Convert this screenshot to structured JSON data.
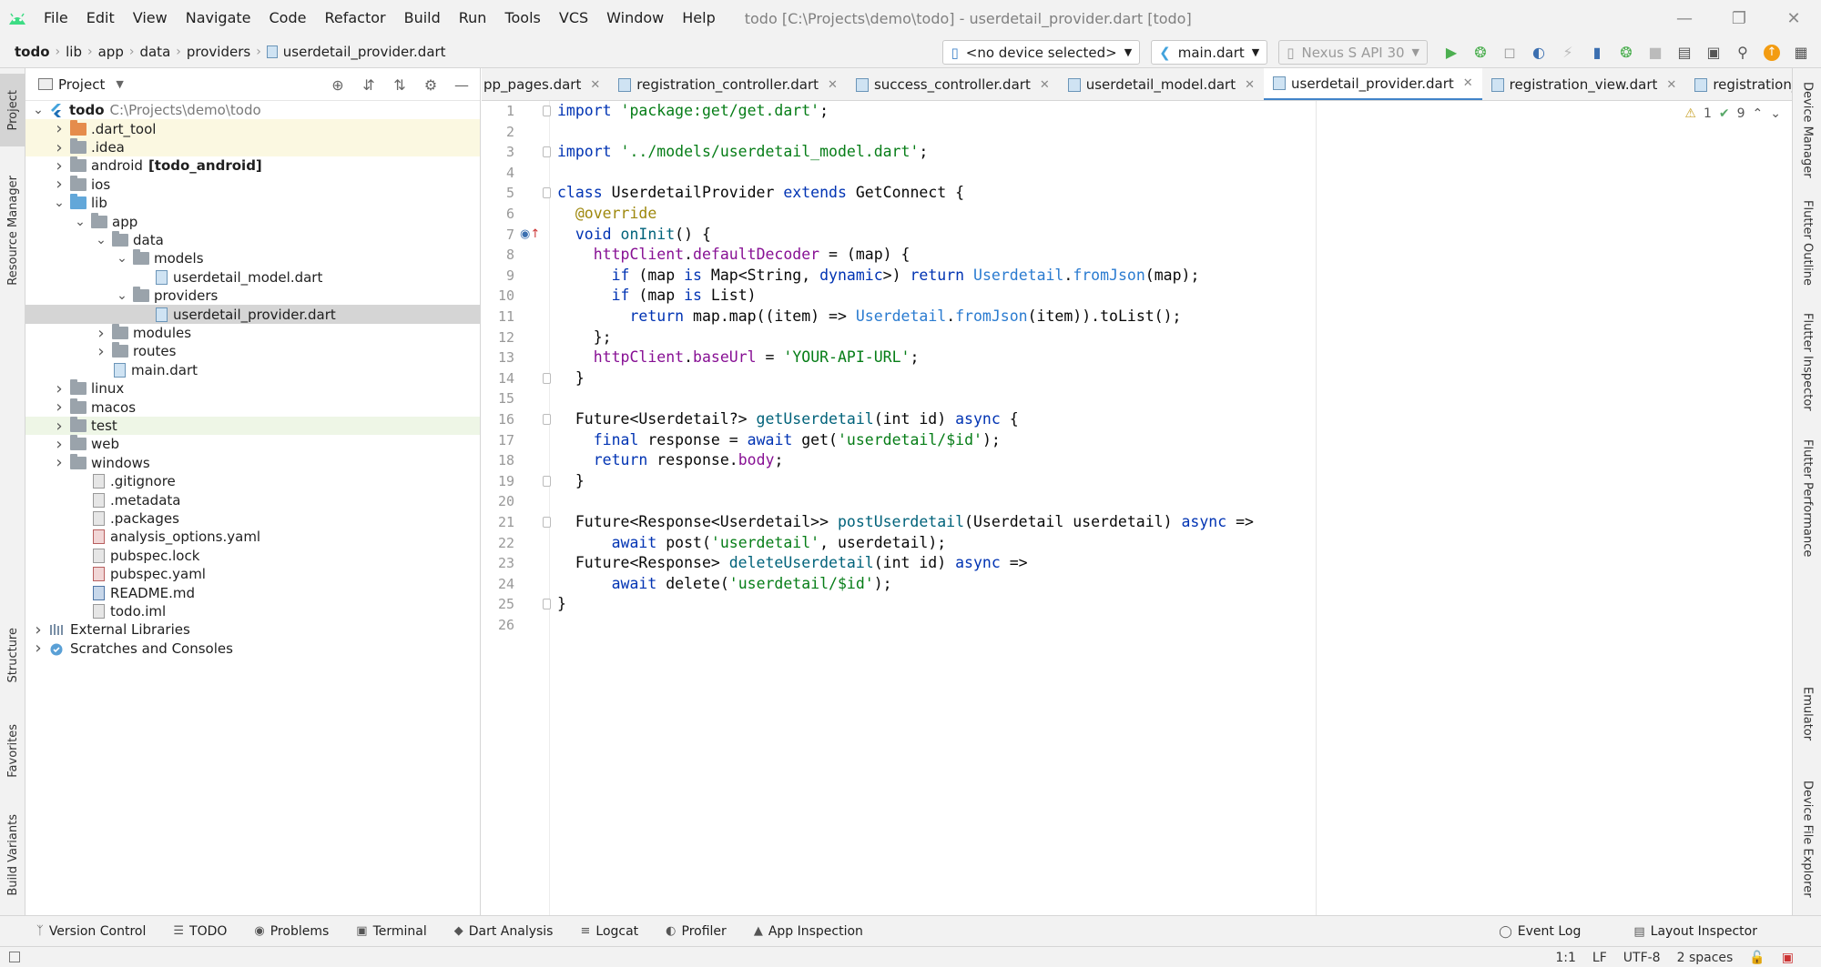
{
  "menu": [
    "File",
    "Edit",
    "View",
    "Navigate",
    "Code",
    "Refactor",
    "Build",
    "Run",
    "Tools",
    "VCS",
    "Window",
    "Help"
  ],
  "window_title": "todo [C:\\Projects\\demo\\todo] - userdetail_provider.dart [todo]",
  "breadcrumb": [
    "todo",
    "lib",
    "app",
    "data",
    "providers",
    "userdetail_provider.dart"
  ],
  "toolbar": {
    "device": "<no device selected>",
    "run_config": "main.dart",
    "emulator": "Nexus S API 30"
  },
  "project_panel": {
    "title": "Project"
  },
  "tree": [
    {
      "label": "todo",
      "note": "C:\\Projects\\demo\\todo",
      "level": 0,
      "arrow": "v",
      "icon": "flutter",
      "bold": true
    },
    {
      "label": ".dart_tool",
      "level": 1,
      "arrow": ">",
      "icon": "folder-orange",
      "style": "excluded"
    },
    {
      "label": ".idea",
      "level": 1,
      "arrow": ">",
      "icon": "folder",
      "style": "excluded"
    },
    {
      "label": "android",
      "note_bold": "[todo_android]",
      "level": 1,
      "arrow": ">",
      "icon": "folder"
    },
    {
      "label": "ios",
      "level": 1,
      "arrow": ">",
      "icon": "folder"
    },
    {
      "label": "lib",
      "level": 1,
      "arrow": "v",
      "icon": "folder-blue"
    },
    {
      "label": "app",
      "level": 2,
      "arrow": "v",
      "icon": "folder"
    },
    {
      "label": "data",
      "level": 3,
      "arrow": "v",
      "icon": "folder"
    },
    {
      "label": "models",
      "level": 4,
      "arrow": "v",
      "icon": "folder"
    },
    {
      "label": "userdetail_model.dart",
      "level": 5,
      "arrow": "",
      "icon": "dart"
    },
    {
      "label": "providers",
      "level": 4,
      "arrow": "v",
      "icon": "folder"
    },
    {
      "label": "userdetail_provider.dart",
      "level": 5,
      "arrow": "",
      "icon": "dart",
      "style": "selected"
    },
    {
      "label": "modules",
      "level": 3,
      "arrow": ">",
      "icon": "folder"
    },
    {
      "label": "routes",
      "level": 3,
      "arrow": ">",
      "icon": "folder"
    },
    {
      "label": "main.dart",
      "level": 3,
      "arrow": "",
      "icon": "dart"
    },
    {
      "label": "linux",
      "level": 1,
      "arrow": ">",
      "icon": "folder"
    },
    {
      "label": "macos",
      "level": 1,
      "arrow": ">",
      "icon": "folder"
    },
    {
      "label": "test",
      "level": 1,
      "arrow": ">",
      "icon": "folder",
      "style": "test"
    },
    {
      "label": "web",
      "level": 1,
      "arrow": ">",
      "icon": "folder"
    },
    {
      "label": "windows",
      "level": 1,
      "arrow": ">",
      "icon": "folder"
    },
    {
      "label": ".gitignore",
      "level": 2,
      "arrow": "",
      "icon": "file"
    },
    {
      "label": ".metadata",
      "level": 2,
      "arrow": "",
      "icon": "file"
    },
    {
      "label": ".packages",
      "level": 2,
      "arrow": "",
      "icon": "file"
    },
    {
      "label": "analysis_options.yaml",
      "level": 2,
      "arrow": "",
      "icon": "yaml"
    },
    {
      "label": "pubspec.lock",
      "level": 2,
      "arrow": "",
      "icon": "file"
    },
    {
      "label": "pubspec.yaml",
      "level": 2,
      "arrow": "",
      "icon": "yaml"
    },
    {
      "label": "README.md",
      "level": 2,
      "arrow": "",
      "icon": "md"
    },
    {
      "label": "todo.iml",
      "level": 2,
      "arrow": "",
      "icon": "file"
    },
    {
      "label": "External Libraries",
      "level": 0,
      "arrow": ">",
      "icon": "libs"
    },
    {
      "label": "Scratches and Consoles",
      "level": 0,
      "arrow": ">",
      "icon": "scratch"
    }
  ],
  "editor_tabs": [
    {
      "label": "pp_pages.dart"
    },
    {
      "label": "registration_controller.dart"
    },
    {
      "label": "success_controller.dart"
    },
    {
      "label": "userdetail_model.dart"
    },
    {
      "label": "userdetail_provider.dart",
      "active": true
    },
    {
      "label": "registration_view.dart"
    },
    {
      "label": "registration_binc"
    }
  ],
  "inspections": {
    "warnings": "1",
    "ok": "9"
  },
  "code_lines": [
    [
      [
        "kw",
        "import "
      ],
      [
        "str",
        "'package:get/get.dart'"
      ],
      [
        "",
        "; "
      ]
    ],
    [],
    [
      [
        "kw",
        "import "
      ],
      [
        "str",
        "'../models/userdetail_model.dart'"
      ],
      [
        "",
        ";"
      ]
    ],
    [],
    [
      [
        "kw",
        "class "
      ],
      [
        "",
        "UserdetailProvider "
      ],
      [
        "kw",
        "extends "
      ],
      [
        "",
        "GetConnect {"
      ]
    ],
    [
      [
        "",
        "  "
      ],
      [
        "ann",
        "@override"
      ]
    ],
    [
      [
        "",
        "  "
      ],
      [
        "kw",
        "void "
      ],
      [
        "fn",
        "onInit"
      ],
      [
        "",
        "() {"
      ]
    ],
    [
      [
        "",
        "    "
      ],
      [
        "fld",
        "httpClient"
      ],
      [
        "",
        "."
      ],
      [
        "fld",
        "defaultDecoder"
      ],
      [
        "",
        " = (map) {"
      ]
    ],
    [
      [
        "",
        "      "
      ],
      [
        "kw",
        "if "
      ],
      [
        "",
        "(map "
      ],
      [
        "kw",
        "is "
      ],
      [
        "",
        "Map<String, "
      ],
      [
        "kw",
        "dynamic"
      ],
      [
        "",
        ">) "
      ],
      [
        "kw",
        "return "
      ],
      [
        "cls",
        "Userdetail"
      ],
      [
        "",
        "."
      ],
      [
        "cls",
        "fromJson"
      ],
      [
        "",
        "(map);"
      ]
    ],
    [
      [
        "",
        "      "
      ],
      [
        "kw",
        "if "
      ],
      [
        "",
        "(map "
      ],
      [
        "kw",
        "is "
      ],
      [
        "",
        "List)"
      ]
    ],
    [
      [
        "",
        "        "
      ],
      [
        "kw",
        "return "
      ],
      [
        "",
        "map.map((item) => "
      ],
      [
        "cls",
        "Userdetail"
      ],
      [
        "",
        "."
      ],
      [
        "cls",
        "fromJson"
      ],
      [
        "",
        "(item)).toList();"
      ]
    ],
    [
      [
        "",
        "    };"
      ]
    ],
    [
      [
        "",
        "    "
      ],
      [
        "fld",
        "httpClient"
      ],
      [
        "",
        "."
      ],
      [
        "fld",
        "baseUrl"
      ],
      [
        "",
        " = "
      ],
      [
        "str",
        "'YOUR-API-URL'"
      ],
      [
        "",
        ";"
      ]
    ],
    [
      [
        "",
        "  }"
      ]
    ],
    [],
    [
      [
        "",
        "  Future<Userdetail?> "
      ],
      [
        "fn",
        "getUserdetail"
      ],
      [
        "",
        "(int id) "
      ],
      [
        "kw",
        "async "
      ],
      [
        "",
        "{"
      ]
    ],
    [
      [
        "",
        "    "
      ],
      [
        "kw",
        "final "
      ],
      [
        "",
        "response = "
      ],
      [
        "kw",
        "await "
      ],
      [
        "",
        "get("
      ],
      [
        "str",
        "'userdetail/$id'"
      ],
      [
        "",
        ");"
      ]
    ],
    [
      [
        "",
        "    "
      ],
      [
        "kw",
        "return "
      ],
      [
        "",
        "response."
      ],
      [
        "fld",
        "body"
      ],
      [
        "",
        ";"
      ]
    ],
    [
      [
        "",
        "  }"
      ]
    ],
    [],
    [
      [
        "",
        "  Future<Response<Userdetail>> "
      ],
      [
        "fn",
        "postUserdetail"
      ],
      [
        "",
        "(Userdetail userdetail) "
      ],
      [
        "kw",
        "async "
      ],
      [
        "",
        "=>"
      ]
    ],
    [
      [
        "",
        "      "
      ],
      [
        "kw",
        "await "
      ],
      [
        "",
        "post("
      ],
      [
        "str",
        "'userdetail'"
      ],
      [
        "",
        ", userdetail);"
      ]
    ],
    [
      [
        "",
        "  Future<Response> "
      ],
      [
        "fn",
        "deleteUserdetail"
      ],
      [
        "",
        "(int id) "
      ],
      [
        "kw",
        "async "
      ],
      [
        "",
        "=>"
      ]
    ],
    [
      [
        "",
        "      "
      ],
      [
        "kw",
        "await "
      ],
      [
        "",
        "delete("
      ],
      [
        "str",
        "'userdetail/$id'"
      ],
      [
        "",
        ");"
      ]
    ],
    [
      [
        "",
        "}"
      ]
    ],
    []
  ],
  "left_strip": [
    "Project",
    "Resource Manager",
    "Structure",
    "Favorites",
    "Build Variants"
  ],
  "right_strip": [
    "Device Manager",
    "Flutter Outline",
    "Flutter Inspector",
    "Flutter Performance",
    "Emulator",
    "Device File Explorer"
  ],
  "bottom_tabs": [
    "Version Control",
    "TODO",
    "Problems",
    "Terminal",
    "Dart Analysis",
    "Logcat",
    "Profiler",
    "App Inspection"
  ],
  "bottom_right": [
    "Event Log",
    "Layout Inspector"
  ],
  "status": {
    "position": "1:1",
    "line_sep": "LF",
    "encoding": "UTF-8",
    "indent": "2 spaces"
  }
}
